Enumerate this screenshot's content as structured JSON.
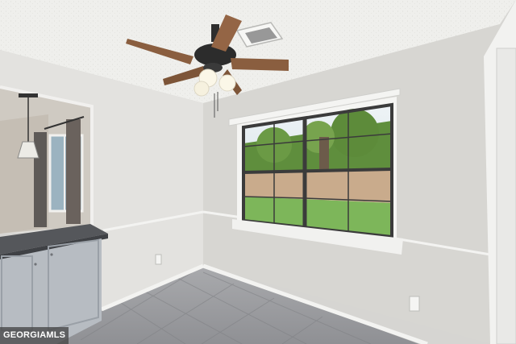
{
  "scene": {
    "watermark": "GEORGIAMLS",
    "colors": {
      "ceiling": "#efefec",
      "right_wall": "#d7d6d2",
      "left_wall": "#e3e2df",
      "floor": "#9c9da0",
      "trim": "#f3f3f1",
      "fan_blade": "#8a5e3f",
      "countertop": "#55575b",
      "cabinet": "#b7bcc2",
      "lawn": "#7db65a",
      "fence": "#c9ab8c"
    },
    "icons": [
      "ceiling-fan-icon",
      "pendant-light-icon",
      "ceiling-vent-icon",
      "outlet-icon"
    ]
  }
}
